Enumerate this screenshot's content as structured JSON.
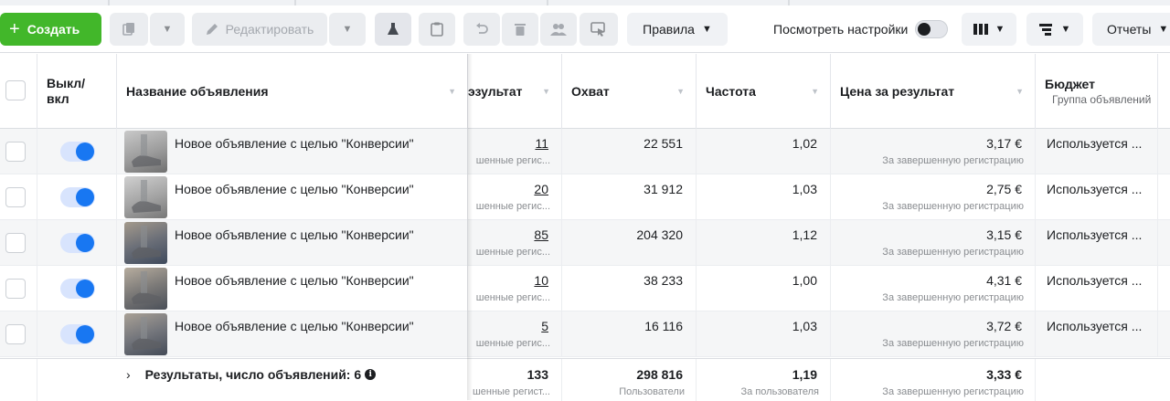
{
  "toolbar": {
    "create_label": "Создать",
    "edit_label": "Редактировать",
    "rules_label": "Правила",
    "view_settings_label": "Посмотреть настройки",
    "reports_label": "Отчеты",
    "icons": [
      "duplicate-icon",
      "pencil-icon",
      "flask-icon",
      "clipboard-icon",
      "undo-icon",
      "trash-icon",
      "people-icon",
      "ad-preview-icon",
      "columns-icon",
      "breakdown-icon"
    ]
  },
  "table": {
    "headers": {
      "toggle": "Выкл/вкл",
      "name": "Название объявления",
      "results": "эзультат",
      "reach": "Охват",
      "frequency": "Частота",
      "cost_per_result": "Цена за результат",
      "budget": "Бюджет",
      "budget_sub": "Группа объявлений"
    },
    "rows": [
      {
        "name": "Новое объявление с целью \"Конверсии\"",
        "results": "11",
        "results_sub": "шенные регис...",
        "reach": "22 551",
        "frequency": "1,02",
        "cost": "3,17 €",
        "cost_sub": "За завершенную регистрацию",
        "budget": "Используется ..."
      },
      {
        "name": "Новое объявление с целью \"Конверсии\"",
        "results": "20",
        "results_sub": "шенные регис...",
        "reach": "31 912",
        "frequency": "1,03",
        "cost": "2,75 €",
        "cost_sub": "За завершенную регистрацию",
        "budget": "Используется ..."
      },
      {
        "name": "Новое объявление с целью \"Конверсии\"",
        "results": "85",
        "results_sub": "шенные регис...",
        "reach": "204 320",
        "frequency": "1,12",
        "cost": "3,15 €",
        "cost_sub": "За завершенную регистрацию",
        "budget": "Используется ..."
      },
      {
        "name": "Новое объявление с целью \"Конверсии\"",
        "results": "10",
        "results_sub": "шенные регис...",
        "reach": "38 233",
        "frequency": "1,00",
        "cost": "4,31 €",
        "cost_sub": "За завершенную регистрацию",
        "budget": "Используется ..."
      },
      {
        "name": "Новое объявление с целью \"Конверсии\"",
        "results": "5",
        "results_sub": "шенные регис...",
        "reach": "16 116",
        "frequency": "1,03",
        "cost": "3,72 €",
        "cost_sub": "За завершенную регистрацию",
        "budget": "Используется ..."
      }
    ],
    "summary": {
      "label": "Результаты, число объявлений: 6",
      "results": "133",
      "results_sub": "шенные регист...",
      "reach": "298 816",
      "reach_sub": "Пользователи",
      "frequency": "1,19",
      "frequency_sub": "За пользователя",
      "cost": "3,33 €",
      "cost_sub": "За завершенную регистрацию"
    }
  },
  "colors": {
    "create": "#42b72a",
    "toggle_on": "#1877f2",
    "header_border": "#dadde1"
  }
}
